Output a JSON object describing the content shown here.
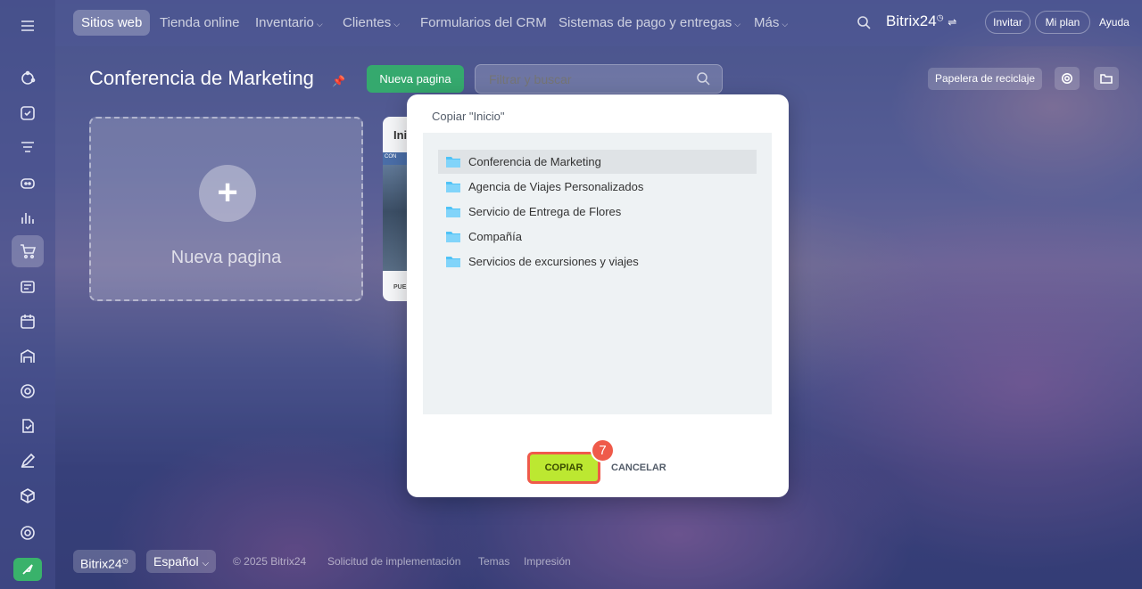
{
  "nav": {
    "tabs": [
      {
        "label": "Sitios web"
      },
      {
        "label": "Tienda online"
      },
      {
        "label": "Inventario"
      },
      {
        "label": "Clientes"
      },
      {
        "label": "Formularios del CRM"
      },
      {
        "label": "Sistemas de pago y entregas"
      },
      {
        "label": "Más"
      }
    ],
    "brand": "Bitrix24",
    "invite_label": "Invitar",
    "plan_label": "Mi plan",
    "help_label": "Ayuda"
  },
  "page": {
    "title": "Conferencia de Marketing",
    "new_page_button": "Nueva pagina",
    "search_placeholder": "Filtrar y buscar",
    "recycle_bin_label": "Papelera de reciclaje"
  },
  "cards": {
    "new_label": "Nueva pagina",
    "plus": "+",
    "site_title": "Ini",
    "site_strip": "CON",
    "site_footer": "PUE"
  },
  "footer": {
    "brand": "Bitrix24",
    "language": "Español",
    "copyright": "© 2025 Bitrix24",
    "links": [
      "Solicitud de implementación",
      "Temas",
      "Impresión"
    ]
  },
  "modal": {
    "title": "Copiar \"Inicio\"",
    "folders": [
      "Conferencia de Marketing",
      "Agencia de Viajes Personalizados",
      "Servicio de Entrega de Flores",
      "Compañía",
      "Servicios de excursiones y viajes"
    ],
    "selected_index": 0,
    "copy_label": "COPIAR",
    "cancel_label": "CANCELAR",
    "step_number": "7"
  },
  "colors": {
    "accent_green": "#35a96e",
    "copy_button": "#bce831",
    "highlight_red": "#ef5a4a",
    "folder_blue": "#4fc3f7"
  }
}
